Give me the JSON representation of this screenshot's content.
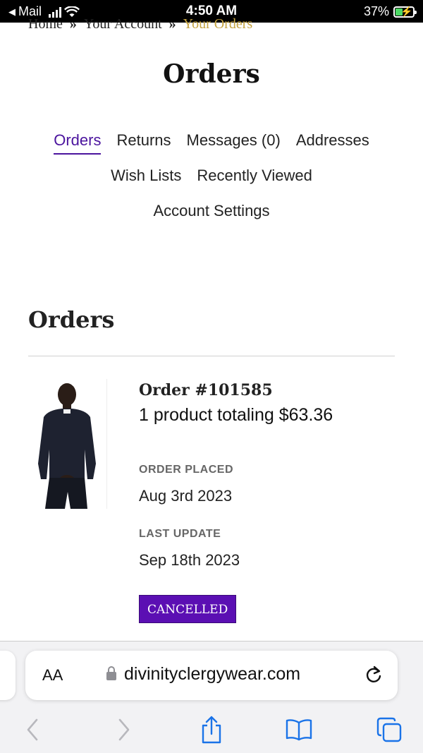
{
  "status_bar": {
    "back_app": "Mail",
    "time": "4:50 AM",
    "battery": "37%"
  },
  "breadcrumb": [
    "Home",
    "Your Account",
    "Your Orders"
  ],
  "breadcrumb_separator": "»",
  "page_title": "Orders",
  "tabs": [
    {
      "label": "Orders",
      "active": true
    },
    {
      "label": "Returns"
    },
    {
      "label": "Messages (0)"
    },
    {
      "label": "Addresses"
    },
    {
      "label": "Wish Lists"
    },
    {
      "label": "Recently Viewed"
    },
    {
      "label": "Account Settings"
    }
  ],
  "section_title": "Orders",
  "order": {
    "number": "Order #101585",
    "summary": "1 product totaling $63.36",
    "placed_label": "ORDER PLACED",
    "placed_value": "Aug 3rd 2023",
    "updated_label": "LAST UPDATE",
    "updated_value": "Sep 18th 2023",
    "status": "CANCELLED",
    "status_color": "#5b0fb3"
  },
  "browser": {
    "text_size_button": "AA",
    "url": "divinityclergywear.com",
    "icons": [
      "back-icon",
      "forward-icon",
      "share-icon",
      "bookmarks-icon",
      "tabs-icon",
      "reload-icon",
      "lock-icon"
    ]
  },
  "colors": {
    "accent": "#4b149e",
    "breadcrumb_current": "#c5a340",
    "ios_blue": "#1a73e8"
  }
}
